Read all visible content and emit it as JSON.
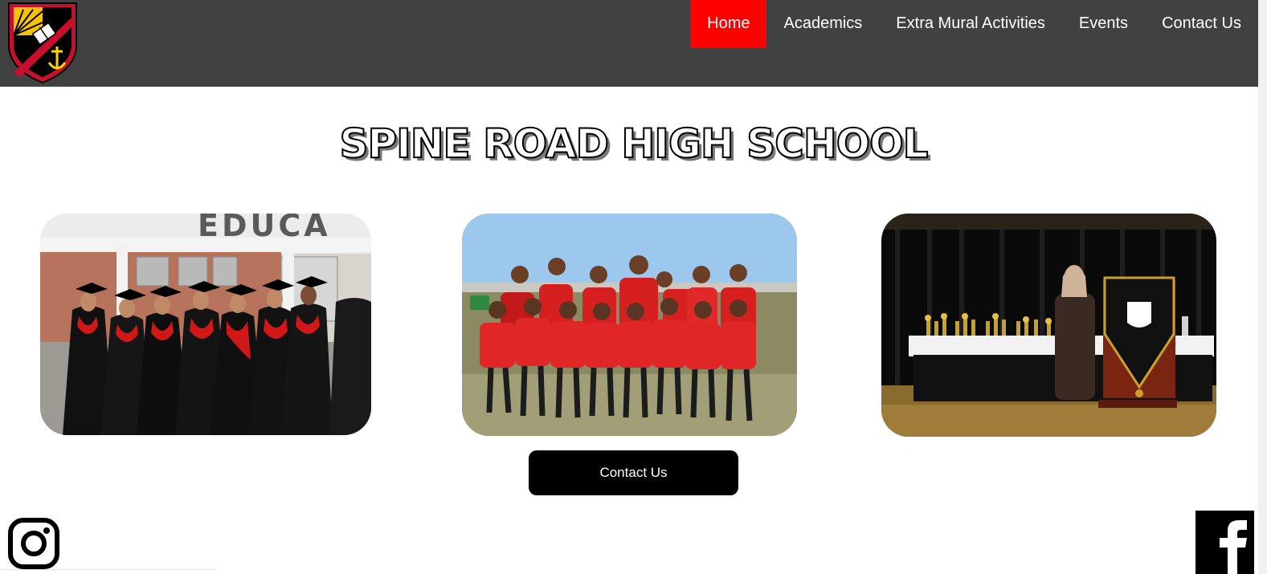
{
  "nav": {
    "items": [
      {
        "label": "Home",
        "active": true
      },
      {
        "label": "Academics",
        "active": false
      },
      {
        "label": "Extra Mural Activities",
        "active": false
      },
      {
        "label": "Events",
        "active": false
      },
      {
        "label": "Contact Us",
        "active": false
      }
    ]
  },
  "hero": {
    "title": "SPINE ROAD HIGH SCHOOL"
  },
  "photos": {
    "graduation_sign_text": "EDUCA"
  },
  "cta": {
    "contact_label": "Contact Us"
  },
  "social": {
    "instagram_icon": "instagram-icon",
    "facebook_icon": "facebook-icon"
  },
  "colors": {
    "header_bg": "#414141",
    "nav_active": "#ff0000",
    "button_bg": "#000000"
  }
}
